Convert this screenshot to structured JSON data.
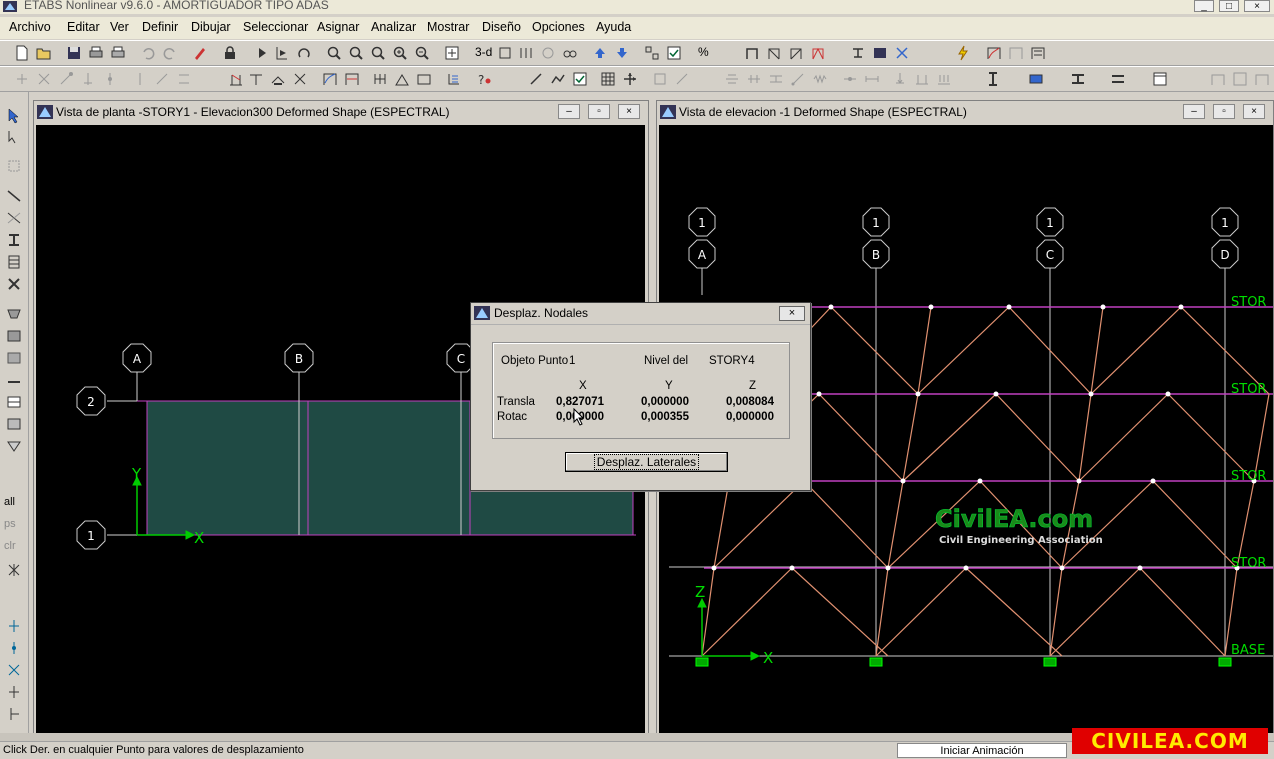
{
  "app": {
    "title": "ETABS Nonlinear v9.6.0 - AMORTIGUADOR TIPO ADAS",
    "window_buttons": [
      "_",
      "□",
      "×"
    ]
  },
  "menu": [
    "Archivo",
    "Editar",
    "Ver",
    "Definir",
    "Dibujar",
    "Seleccionar",
    "Asignar",
    "Analizar",
    "Mostrar",
    "Diseño",
    "Opciones",
    "Ayuda"
  ],
  "toolbar": {
    "view_3d": "3-d",
    "percent": "%"
  },
  "left_toolbar": {
    "all": "all",
    "ps": "ps",
    "clr": "clr"
  },
  "plan_view": {
    "title": "Vista de planta -STORY1 - Elevacion300  Deformed Shape (ESPECTRAL)",
    "grid_labels": {
      "a": "A",
      "b": "B",
      "c": "C",
      "row2": "2",
      "row1": "1"
    },
    "axis_x": "X",
    "axis_y": "Y",
    "colors": {
      "slab": "#1f4a44",
      "grid": "#d040d0",
      "label": "#ffffff"
    }
  },
  "elev_view": {
    "title": "Vista de elevacion -1  Deformed Shape (ESPECTRAL)",
    "bubbles_top": [
      "1",
      "1",
      "1",
      "1"
    ],
    "bubbles_letter": [
      "A",
      "B",
      "C",
      "D"
    ],
    "story_labels": [
      "STOR",
      "STOR",
      "STOR",
      "STOR",
      "BASE"
    ],
    "axis_x": "X",
    "axis_z": "Z",
    "colors": {
      "frame": "#e09070",
      "story": "#c040c0",
      "support": "#00cc00",
      "label": "#00dd00"
    }
  },
  "dialog": {
    "title": "Desplaz. Nodales",
    "close": "×",
    "objeto_label": "Objeto Punto",
    "objeto_value": "1",
    "nivel_label": "Nivel del",
    "nivel_value": "STORY4",
    "col_x": "X",
    "col_y": "Y",
    "col_z": "Z",
    "transla_label": "Transla",
    "rotac_label": "Rotac",
    "transla": [
      "0,827071",
      "0,000000",
      "0,008084"
    ],
    "rotac": [
      "0,000000",
      "0,000355",
      "0,000000"
    ],
    "button": "Desplaz. Laterales"
  },
  "watermark": {
    "brand": "CivilEA.com",
    "tagline": "Civil Engineering Association",
    "corner": "CIVILEA.COM"
  },
  "status": {
    "message": "Click Der. en cualquier Punto para valores de desplazamiento",
    "anim_button": "Iniciar Animación"
  }
}
